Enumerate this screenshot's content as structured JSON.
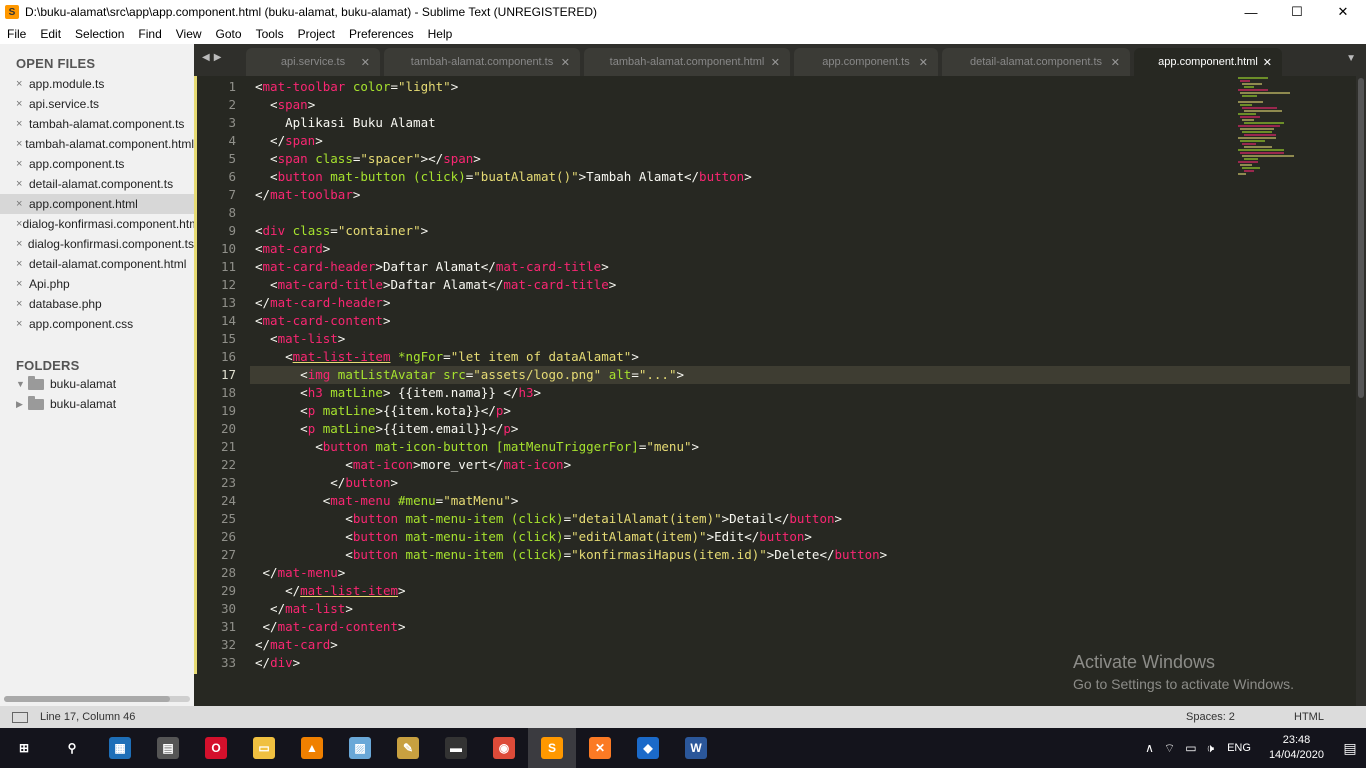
{
  "window": {
    "title": "D:\\buku-alamat\\src\\app\\app.component.html (buku-alamat, buku-alamat) - Sublime Text (UNREGISTERED)",
    "controls": {
      "minimize": "—",
      "maximize": "☐",
      "close": "✕"
    }
  },
  "menu": [
    "File",
    "Edit",
    "Selection",
    "Find",
    "View",
    "Goto",
    "Tools",
    "Project",
    "Preferences",
    "Help"
  ],
  "sidebar": {
    "open_files_title": "OPEN FILES",
    "files": [
      "app.module.ts",
      "api.service.ts",
      "tambah-alamat.component.ts",
      "tambah-alamat.component.html",
      "app.component.ts",
      "detail-alamat.component.ts",
      "app.component.html",
      "dialog-konfirmasi.component.html",
      "dialog-konfirmasi.component.ts",
      "detail-alamat.component.html",
      "Api.php",
      "database.php",
      "app.component.css"
    ],
    "active_file_index": 6,
    "folders_title": "FOLDERS",
    "folders": [
      {
        "name": "buku-alamat",
        "expanded": true
      },
      {
        "name": "buku-alamat",
        "expanded": false
      }
    ]
  },
  "tabs": [
    {
      "label": "api.service.ts",
      "close": "✕"
    },
    {
      "label": "tambah-alamat.component.ts",
      "close": "✕"
    },
    {
      "label": "tambah-alamat.component.html",
      "close": "✕"
    },
    {
      "label": "app.component.ts",
      "close": "✕"
    },
    {
      "label": "detail-alamat.component.ts",
      "close": "✕"
    },
    {
      "label": "app.component.html",
      "close": "✕"
    }
  ],
  "active_tab_index": 5,
  "editor": {
    "current_line": 17,
    "line_numbers": [
      "1",
      "2",
      "3",
      "4",
      "5",
      "6",
      "7",
      "8",
      "9",
      "10",
      "11",
      "12",
      "13",
      "14",
      "15",
      "16",
      "17",
      "18",
      "19",
      "20",
      "21",
      "22",
      "23",
      "24",
      "25",
      "26",
      "27",
      "28",
      "29",
      "30",
      "31",
      "32",
      "33"
    ],
    "lines": [
      [
        {
          "c": "p",
          "t": "<"
        },
        {
          "c": "t",
          "t": "mat-toolbar"
        },
        {
          "c": "p",
          "t": " "
        },
        {
          "c": "a",
          "t": "color"
        },
        {
          "c": "p",
          "t": "="
        },
        {
          "c": "s",
          "t": "\"light\""
        },
        {
          "c": "p",
          "t": ">"
        }
      ],
      [
        {
          "c": "p",
          "t": "  <"
        },
        {
          "c": "t",
          "t": "span"
        },
        {
          "c": "p",
          "t": ">"
        }
      ],
      [
        {
          "c": "p",
          "t": "    Aplikasi Buku Alamat"
        }
      ],
      [
        {
          "c": "p",
          "t": "  </"
        },
        {
          "c": "t",
          "t": "span"
        },
        {
          "c": "p",
          "t": ">"
        }
      ],
      [
        {
          "c": "p",
          "t": "  <"
        },
        {
          "c": "t",
          "t": "span"
        },
        {
          "c": "p",
          "t": " "
        },
        {
          "c": "a",
          "t": "class"
        },
        {
          "c": "p",
          "t": "="
        },
        {
          "c": "s",
          "t": "\"spacer\""
        },
        {
          "c": "p",
          "t": "></"
        },
        {
          "c": "t",
          "t": "span"
        },
        {
          "c": "p",
          "t": ">"
        }
      ],
      [
        {
          "c": "p",
          "t": "  <"
        },
        {
          "c": "t",
          "t": "button"
        },
        {
          "c": "p",
          "t": " "
        },
        {
          "c": "a",
          "t": "mat-button (click)"
        },
        {
          "c": "p",
          "t": "="
        },
        {
          "c": "s",
          "t": "\"buatAlamat()\""
        },
        {
          "c": "p",
          "t": ">Tambah Alamat</"
        },
        {
          "c": "t",
          "t": "button"
        },
        {
          "c": "p",
          "t": ">"
        }
      ],
      [
        {
          "c": "p",
          "t": "</"
        },
        {
          "c": "t",
          "t": "mat-toolbar"
        },
        {
          "c": "p",
          "t": ">"
        }
      ],
      [
        {
          "c": "p",
          "t": ""
        }
      ],
      [
        {
          "c": "p",
          "t": "<"
        },
        {
          "c": "t",
          "t": "div"
        },
        {
          "c": "p",
          "t": " "
        },
        {
          "c": "a",
          "t": "class"
        },
        {
          "c": "p",
          "t": "="
        },
        {
          "c": "s",
          "t": "\"container\""
        },
        {
          "c": "p",
          "t": ">"
        }
      ],
      [
        {
          "c": "p",
          "t": "<"
        },
        {
          "c": "t",
          "t": "mat-card"
        },
        {
          "c": "p",
          "t": ">"
        }
      ],
      [
        {
          "c": "p",
          "t": "<"
        },
        {
          "c": "t",
          "t": "mat-card-header"
        },
        {
          "c": "p",
          "t": ">Daftar Alamat</"
        },
        {
          "c": "t",
          "t": "mat-card-title"
        },
        {
          "c": "p",
          "t": ">"
        }
      ],
      [
        {
          "c": "p",
          "t": "  <"
        },
        {
          "c": "t",
          "t": "mat-card-title"
        },
        {
          "c": "p",
          "t": ">Daftar Alamat</"
        },
        {
          "c": "t",
          "t": "mat-card-title"
        },
        {
          "c": "p",
          "t": ">"
        }
      ],
      [
        {
          "c": "p",
          "t": "</"
        },
        {
          "c": "t",
          "t": "mat-card-header"
        },
        {
          "c": "p",
          "t": ">"
        }
      ],
      [
        {
          "c": "p",
          "t": "<"
        },
        {
          "c": "t",
          "t": "mat-card-content"
        },
        {
          "c": "p",
          "t": ">"
        }
      ],
      [
        {
          "c": "p",
          "t": "  <"
        },
        {
          "c": "t",
          "t": "mat-list"
        },
        {
          "c": "p",
          "t": ">"
        }
      ],
      [
        {
          "c": "p",
          "t": "    <"
        },
        {
          "c": "tu",
          "t": "mat-list-item"
        },
        {
          "c": "p",
          "t": " "
        },
        {
          "c": "a",
          "t": "*ngFor"
        },
        {
          "c": "p",
          "t": "="
        },
        {
          "c": "s",
          "t": "\"let item of dataAlamat\""
        },
        {
          "c": "p",
          "t": ">"
        }
      ],
      [
        {
          "c": "p",
          "t": "      <"
        },
        {
          "c": "t",
          "t": "img"
        },
        {
          "c": "p",
          "t": " "
        },
        {
          "c": "a",
          "t": "matListAvatar src"
        },
        {
          "c": "p",
          "t": "="
        },
        {
          "c": "s",
          "t": "\"assets/logo.png\""
        },
        {
          "c": "p",
          "t": " "
        },
        {
          "c": "a",
          "t": "alt"
        },
        {
          "c": "p",
          "t": "="
        },
        {
          "c": "s",
          "t": "\"...\""
        },
        {
          "c": "p",
          "t": ">"
        }
      ],
      [
        {
          "c": "p",
          "t": "      <"
        },
        {
          "c": "t",
          "t": "h3"
        },
        {
          "c": "p",
          "t": " "
        },
        {
          "c": "a",
          "t": "matLine"
        },
        {
          "c": "p",
          "t": "> {{item.nama}} </"
        },
        {
          "c": "t",
          "t": "h3"
        },
        {
          "c": "p",
          "t": ">"
        }
      ],
      [
        {
          "c": "p",
          "t": "      <"
        },
        {
          "c": "t",
          "t": "p"
        },
        {
          "c": "p",
          "t": " "
        },
        {
          "c": "a",
          "t": "matLine"
        },
        {
          "c": "p",
          "t": ">{{item.kota}}</"
        },
        {
          "c": "t",
          "t": "p"
        },
        {
          "c": "p",
          "t": ">"
        }
      ],
      [
        {
          "c": "p",
          "t": "      <"
        },
        {
          "c": "t",
          "t": "p"
        },
        {
          "c": "p",
          "t": " "
        },
        {
          "c": "a",
          "t": "matLine"
        },
        {
          "c": "p",
          "t": ">{{item.email}}</"
        },
        {
          "c": "t",
          "t": "p"
        },
        {
          "c": "p",
          "t": ">"
        }
      ],
      [
        {
          "c": "p",
          "t": "        <"
        },
        {
          "c": "t",
          "t": "button"
        },
        {
          "c": "p",
          "t": " "
        },
        {
          "c": "a",
          "t": "mat-icon-button [matMenuTriggerFor]"
        },
        {
          "c": "p",
          "t": "="
        },
        {
          "c": "s",
          "t": "\"menu\""
        },
        {
          "c": "p",
          "t": ">"
        }
      ],
      [
        {
          "c": "p",
          "t": "            <"
        },
        {
          "c": "t",
          "t": "mat-icon"
        },
        {
          "c": "p",
          "t": ">more_vert</"
        },
        {
          "c": "t",
          "t": "mat-icon"
        },
        {
          "c": "p",
          "t": ">"
        }
      ],
      [
        {
          "c": "p",
          "t": "          </"
        },
        {
          "c": "t",
          "t": "button"
        },
        {
          "c": "p",
          "t": ">"
        }
      ],
      [
        {
          "c": "p",
          "t": "         <"
        },
        {
          "c": "t",
          "t": "mat-menu"
        },
        {
          "c": "p",
          "t": " "
        },
        {
          "c": "a",
          "t": "#menu"
        },
        {
          "c": "p",
          "t": "="
        },
        {
          "c": "s",
          "t": "\"matMenu\""
        },
        {
          "c": "p",
          "t": ">"
        }
      ],
      [
        {
          "c": "p",
          "t": "            <"
        },
        {
          "c": "t",
          "t": "button"
        },
        {
          "c": "p",
          "t": " "
        },
        {
          "c": "a",
          "t": "mat-menu-item (click)"
        },
        {
          "c": "p",
          "t": "="
        },
        {
          "c": "s",
          "t": "\"detailAlamat(item)\""
        },
        {
          "c": "p",
          "t": ">Detail</"
        },
        {
          "c": "t",
          "t": "button"
        },
        {
          "c": "p",
          "t": ">"
        }
      ],
      [
        {
          "c": "p",
          "t": "            <"
        },
        {
          "c": "t",
          "t": "button"
        },
        {
          "c": "p",
          "t": " "
        },
        {
          "c": "a",
          "t": "mat-menu-item (click)"
        },
        {
          "c": "p",
          "t": "="
        },
        {
          "c": "s",
          "t": "\"editAlamat(item)\""
        },
        {
          "c": "p",
          "t": ">Edit</"
        },
        {
          "c": "t",
          "t": "button"
        },
        {
          "c": "p",
          "t": ">"
        }
      ],
      [
        {
          "c": "p",
          "t": "            <"
        },
        {
          "c": "t",
          "t": "button"
        },
        {
          "c": "p",
          "t": " "
        },
        {
          "c": "a",
          "t": "mat-menu-item (click)"
        },
        {
          "c": "p",
          "t": "="
        },
        {
          "c": "s",
          "t": "\"konfirmasiHapus(item.id)\""
        },
        {
          "c": "p",
          "t": ">Delete</"
        },
        {
          "c": "t",
          "t": "button"
        },
        {
          "c": "p",
          "t": ">"
        }
      ],
      [
        {
          "c": "p",
          "t": " </"
        },
        {
          "c": "t",
          "t": "mat-menu"
        },
        {
          "c": "p",
          "t": ">"
        }
      ],
      [
        {
          "c": "p",
          "t": "    </"
        },
        {
          "c": "tu",
          "t": "mat-list-item"
        },
        {
          "c": "p",
          "t": ">"
        }
      ],
      [
        {
          "c": "p",
          "t": "  </"
        },
        {
          "c": "t",
          "t": "mat-list"
        },
        {
          "c": "p",
          "t": ">"
        }
      ],
      [
        {
          "c": "p",
          "t": " </"
        },
        {
          "c": "t",
          "t": "mat-card-content"
        },
        {
          "c": "p",
          "t": ">"
        }
      ],
      [
        {
          "c": "p",
          "t": "</"
        },
        {
          "c": "t",
          "t": "mat-card"
        },
        {
          "c": "p",
          "t": ">"
        }
      ],
      [
        {
          "c": "p",
          "t": "</"
        },
        {
          "c": "t",
          "t": "div"
        },
        {
          "c": "p",
          "t": ">"
        }
      ]
    ]
  },
  "watermark": {
    "title": "Activate Windows",
    "subtitle": "Go to Settings to activate Windows."
  },
  "status": {
    "position": "Line 17, Column 46",
    "spaces": "Spaces: 2",
    "syntax": "HTML"
  },
  "taskbar": {
    "apps": [
      {
        "name": "start-icon",
        "glyph": "⊞",
        "bg": "",
        "active": false
      },
      {
        "name": "search-icon",
        "glyph": "⚲",
        "bg": "",
        "active": false
      },
      {
        "name": "task-manager-icon",
        "glyph": "▦",
        "bg": "#1e6fb8",
        "active": false
      },
      {
        "name": "calendar-app-icon",
        "glyph": "▤",
        "bg": "#555555",
        "active": false
      },
      {
        "name": "opera-icon",
        "glyph": "O",
        "bg": "#d4102c",
        "active": false
      },
      {
        "name": "file-explorer-icon",
        "glyph": "▭",
        "bg": "#f0c040",
        "active": false
      },
      {
        "name": "vlc-icon",
        "glyph": "▲",
        "bg": "#f08000",
        "active": false
      },
      {
        "name": "notepad-icon",
        "glyph": "▨",
        "bg": "#6aa8d8",
        "active": false
      },
      {
        "name": "tools-icon",
        "glyph": "✎",
        "bg": "#c8a040",
        "active": false
      },
      {
        "name": "terminal-icon",
        "glyph": "▬",
        "bg": "#333333",
        "active": false
      },
      {
        "name": "chrome-icon",
        "glyph": "◉",
        "bg": "#dd4b39",
        "active": false
      },
      {
        "name": "sublime-text-icon",
        "glyph": "S",
        "bg": "#ff9800",
        "active": true
      },
      {
        "name": "xampp-icon",
        "glyph": "✕",
        "bg": "#fb7a24",
        "active": false
      },
      {
        "name": "virtualbox-icon",
        "glyph": "◆",
        "bg": "#1b6ac9",
        "active": false
      },
      {
        "name": "word-icon",
        "glyph": "W",
        "bg": "#2b579a",
        "active": false
      }
    ],
    "tray": {
      "language": "ENG",
      "time": "23:48",
      "date": "14/04/2020"
    }
  },
  "colors": {
    "editor_bg": "#272822",
    "tag": "#f92672",
    "attribute": "#a6e22e",
    "string": "#e6db74",
    "text": "#f8f8f2",
    "sublime_accent": "#ff9800"
  }
}
